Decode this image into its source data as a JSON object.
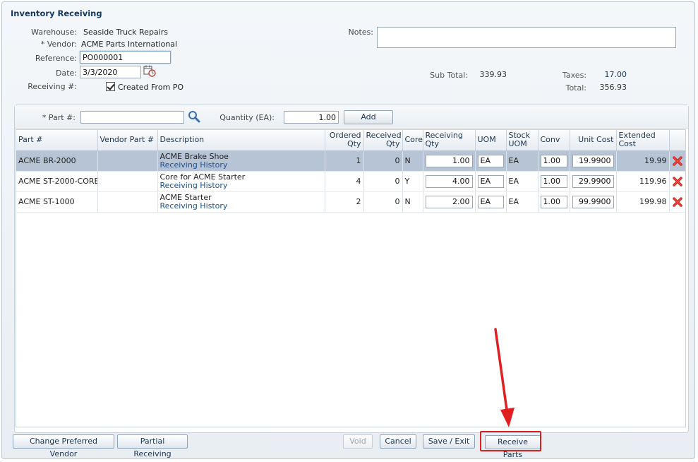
{
  "window": {
    "title": "Inventory Receiving"
  },
  "header": {
    "warehouse_label": "Warehouse:",
    "warehouse_value": "Seaside Truck Repairs",
    "vendor_label": "* Vendor:",
    "vendor_value": "ACME Parts International",
    "reference_label": "Reference:",
    "reference_value": "PO000001",
    "date_label": "Date:",
    "date_value": "3/3/2020",
    "receiving_label": "Receiving #:",
    "created_from_po_label": "Created From PO",
    "created_from_po_checked": true,
    "notes_label": "Notes:",
    "notes_value": ""
  },
  "summary": {
    "subtotal_label": "Sub Total:",
    "subtotal_value": "339.93",
    "taxes_label": "Taxes:",
    "taxes_value": "17.00",
    "total_label": "Total:",
    "total_value": "356.93"
  },
  "add_bar": {
    "part_label": "* Part #:",
    "part_value": "",
    "qty_label": "Quantity (EA):",
    "qty_value": "1.00",
    "add_label": "Add"
  },
  "table": {
    "columns": [
      "Part #",
      "Vendor Part #",
      "Description",
      "Ordered Qty",
      "Received Qty",
      "Core",
      "Receiving Qty",
      "UOM",
      "Stock UOM",
      "Conv",
      "Unit Cost",
      "Extended Cost"
    ],
    "rows": [
      {
        "part": "ACME BR-2000",
        "vendor_part": "",
        "description": "ACME Brake Shoe",
        "history": "Receiving History",
        "ordered": "1",
        "received": "0",
        "core": "N",
        "receiving_qty": "1.00",
        "uom": "EA",
        "stock_uom": "EA",
        "conv": "1.00",
        "unit_cost": "19.9900",
        "extended": "19.99"
      },
      {
        "part": "ACME ST-2000-CORE",
        "vendor_part": "",
        "description": "Core for ACME Starter",
        "history": "Receiving History",
        "ordered": "4",
        "received": "0",
        "core": "Y",
        "receiving_qty": "4.00",
        "uom": "EA",
        "stock_uom": "EA",
        "conv": "1.00",
        "unit_cost": "29.9900",
        "extended": "119.96"
      },
      {
        "part": "ACME ST-1000",
        "vendor_part": "",
        "description": "ACME Starter",
        "history": "Receiving History",
        "ordered": "2",
        "received": "0",
        "core": "N",
        "receiving_qty": "2.00",
        "uom": "EA",
        "stock_uom": "EA",
        "conv": "1.00",
        "unit_cost": "99.9900",
        "extended": "199.98"
      }
    ]
  },
  "footer": {
    "change_vendor": "Change Preferred Vendor",
    "partial_receiving": "Partial Receiving",
    "void": "Void",
    "cancel": "Cancel",
    "save_exit": "Save / Exit",
    "receive_parts": "Receive Parts"
  },
  "icons": {
    "calendar": "calendar-icon",
    "search": "search-icon",
    "delete": "delete-x-icon",
    "annotation_arrow": "red-arrow-annotation"
  },
  "colors": {
    "title": "#14385e",
    "link": "#1e4f8c",
    "selected_row": "#b7c4d6",
    "delete_icon": "#d4201a",
    "annotation": "#e02020"
  }
}
